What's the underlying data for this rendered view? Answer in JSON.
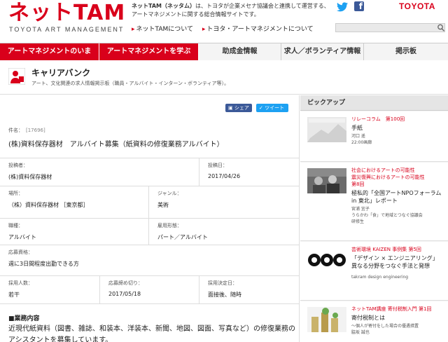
{
  "header": {
    "logo_text": "ネットTAM",
    "logo_sub": "TOYOTA ART MANAGEMENT",
    "intro_bold": "ネットTAM（ネッタム）",
    "intro_rest": "は、トヨタが企業メセナ協議会と連携して運営する、アートマネジメントに関する総合情報サイトです。",
    "links": [
      "ネットTAMについて",
      "トヨタ・アートマネジメントについて"
    ],
    "brand": "TOYOTA",
    "search_placeholder": ""
  },
  "nav": [
    {
      "label": "アートマネジメントのいま",
      "active": true
    },
    {
      "label": "アートマネジメントを学ぶ",
      "active": true
    },
    {
      "label": "助成金情報",
      "active": false
    },
    {
      "label": "求人／ボランティア情報",
      "active": false
    },
    {
      "label": "掲示板",
      "active": false
    }
  ],
  "page": {
    "title": "キャリアバンク",
    "desc": "アート、文化関連の求人情報掲示板（職員・アルバイト・インターン・ボランティア等）。"
  },
  "share": {
    "fb": "シェア",
    "tw": "ツイート"
  },
  "job": {
    "subject_label": "件名：",
    "subject_id": "[17696]",
    "subject": "(株)資料保存器材　アルバイト募集（紙資料の修復業務アルバイト）",
    "poster_label": "投稿者：",
    "poster": "(株)資料保存器材",
    "date_label": "投稿日：",
    "date": "2017/04/26",
    "place_label": "場所：",
    "place": "（株）資料保存器材 ［東京都］",
    "genre_label": "ジャンル：",
    "genre": "美術",
    "role_label": "職種：",
    "role": "アルバイト",
    "employ_label": "雇用形態：",
    "employ": "パート／アルバイト",
    "qual_label": "応募資格：",
    "qual": "週に3日間程度出勤できる方",
    "count_label": "採用人数：",
    "count": "若干",
    "deadline_label": "応募締め切り：",
    "deadline": "2017/05/18",
    "decide_label": "採用決定日：",
    "decide": "面接後、随時",
    "section_head": "■業務内容",
    "section_body": "近現代紙資料（図書、雑誌、和装本、洋装本、新聞、地図、図面、写真など）の修復業務のアシスタントを募集しています。"
  },
  "sidebar": {
    "heading": "ピックアップ",
    "items": [
      {
        "cat": "リレーコラム　第100回",
        "title": "手紙",
        "meta": "河口 遥\n22:00画廊"
      },
      {
        "cat": "社会におけるアートの可能性\n震災復興におけるアートの可能性\n第8回",
        "title": "極私的「全国アートNPOフォーラム in 東北」レポート",
        "meta": "宮浦 宜子\nうらかわ「食」で地域とつなぐ協議会\n研修生"
      },
      {
        "cat": "芸術環境 KAIZEN 事例集 第5回",
        "title": "「デザイン × エンジニアリング」\n異なる分野をつなぐ手法と発想",
        "meta": "takram design engineering"
      },
      {
        "cat": "ネットTAM講座 寄付税制入門 第1回",
        "title": "寄付税制とは",
        "meta": "〜個人が寄付をした場合の優遇措置\n脇坂 誠也"
      }
    ]
  }
}
